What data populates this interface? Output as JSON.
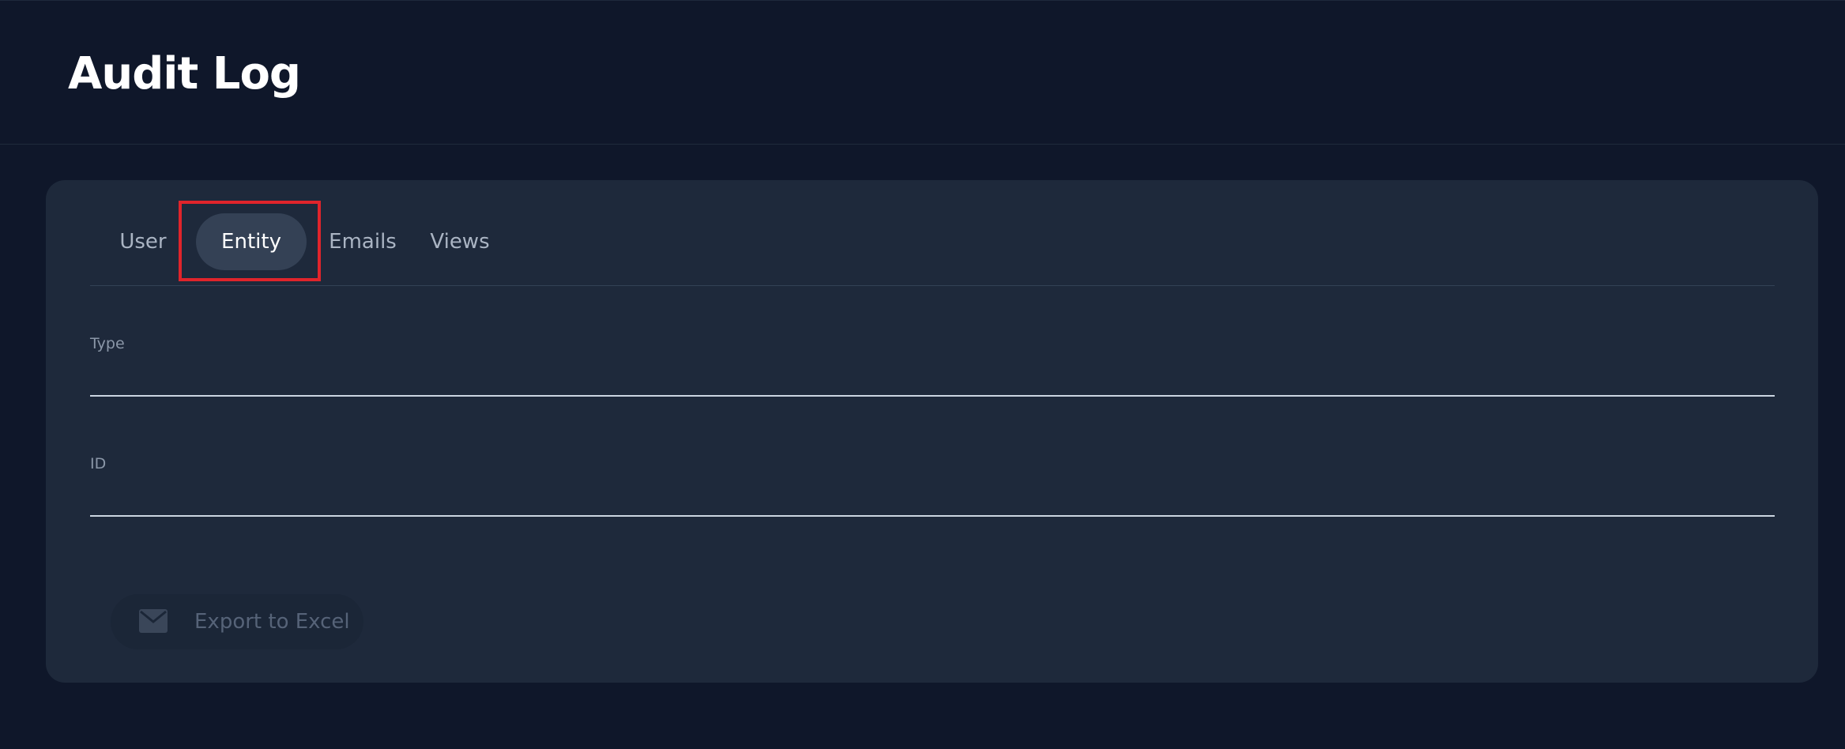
{
  "header": {
    "title": "Audit Log"
  },
  "tabs": [
    {
      "label": "User",
      "active": false
    },
    {
      "label": "Entity",
      "active": true
    },
    {
      "label": "Emails",
      "active": false
    },
    {
      "label": "Views",
      "active": false
    }
  ],
  "form": {
    "type_label": "Type",
    "type_value": "",
    "id_label": "ID",
    "id_value": ""
  },
  "actions": {
    "export_label": "Export to Excel",
    "export_icon": "mail-icon",
    "export_disabled": true
  },
  "colors": {
    "background": "#0f172a",
    "card": "#1e293b",
    "active_tab": "#344155",
    "highlight": "#e0242b"
  }
}
